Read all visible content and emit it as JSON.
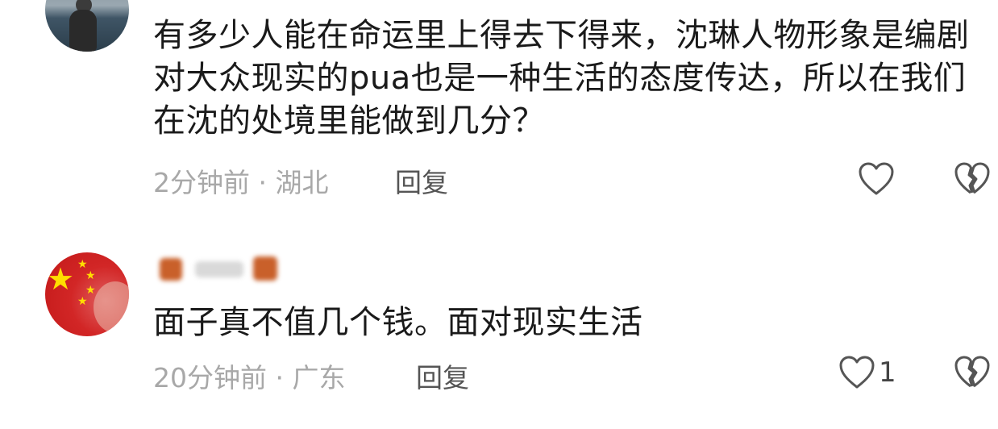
{
  "comments": [
    {
      "avatar": "sea-photo-avatar",
      "text": "有多少人能在命运里上得去下得来，沈琳人物形象是编剧对大众现实的pua也是一种生活的态度传达，所以在我们在沈的处境里能做到几分？",
      "meta": "2分钟前 · 湖北",
      "reply_label": "回复",
      "like_count": "",
      "icons": {
        "like": "heart-outline-icon",
        "dislike": "broken-heart-icon"
      }
    },
    {
      "avatar": "china-flag-avatar",
      "username": "",
      "text": "面子真不值几个钱。面对现实生活",
      "meta": "20分钟前 · 广东",
      "reply_label": "回复",
      "like_count": "1",
      "icons": {
        "like": "heart-outline-icon",
        "dislike": "broken-heart-icon"
      }
    }
  ],
  "colors": {
    "text": "#1a1a1a",
    "meta": "#a8a8a8",
    "reply": "#555555",
    "icon": "#555555",
    "flag_red": "#d22626",
    "flag_star": "#ffde00"
  }
}
